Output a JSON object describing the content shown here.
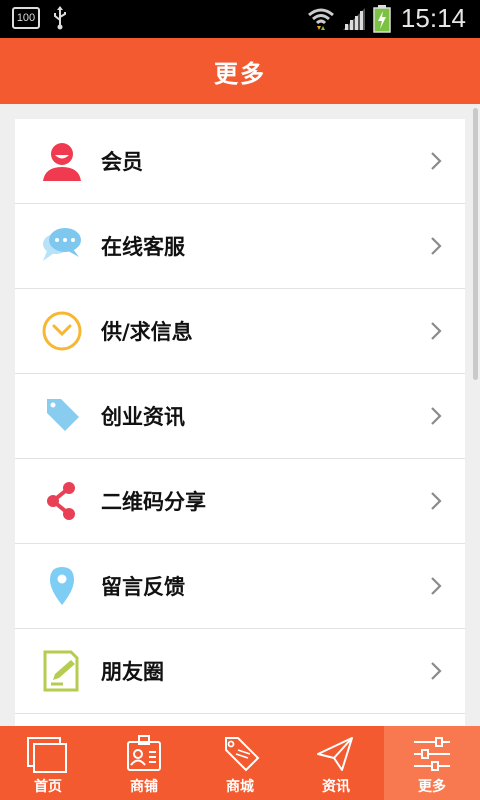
{
  "status_bar": {
    "battery_badge": "100",
    "time": "15:14"
  },
  "header": {
    "title": "更多"
  },
  "menu": {
    "items": [
      {
        "label": "会员",
        "icon": "member-icon"
      },
      {
        "label": "在线客服",
        "icon": "chat-bubble-icon"
      },
      {
        "label": "供/求信息",
        "icon": "clock-icon"
      },
      {
        "label": "创业资讯",
        "icon": "tag-icon"
      },
      {
        "label": "二维码分享",
        "icon": "share-icon"
      },
      {
        "label": "留言反馈",
        "icon": "location-pin-icon"
      },
      {
        "label": "朋友圈",
        "icon": "edit-note-icon"
      }
    ]
  },
  "tabbar": {
    "tabs": [
      {
        "label": "首页",
        "icon": "home-pages-icon"
      },
      {
        "label": "商铺",
        "icon": "id-card-icon"
      },
      {
        "label": "商城",
        "icon": "sale-tag-icon"
      },
      {
        "label": "资讯",
        "icon": "paper-plane-icon"
      },
      {
        "label": "更多",
        "icon": "sliders-icon",
        "active": true
      }
    ]
  },
  "colors": {
    "brand": "#f45a30",
    "tab_active": "#f8794f",
    "member_red": "#f03a4f",
    "chat_blue": "#7ec8f0",
    "clock_orange": "#f7b733",
    "tag_blue": "#88cdf0",
    "share_red": "#e84055",
    "pin_blue": "#7ecdf5",
    "edit_green": "#b6cc4e"
  }
}
